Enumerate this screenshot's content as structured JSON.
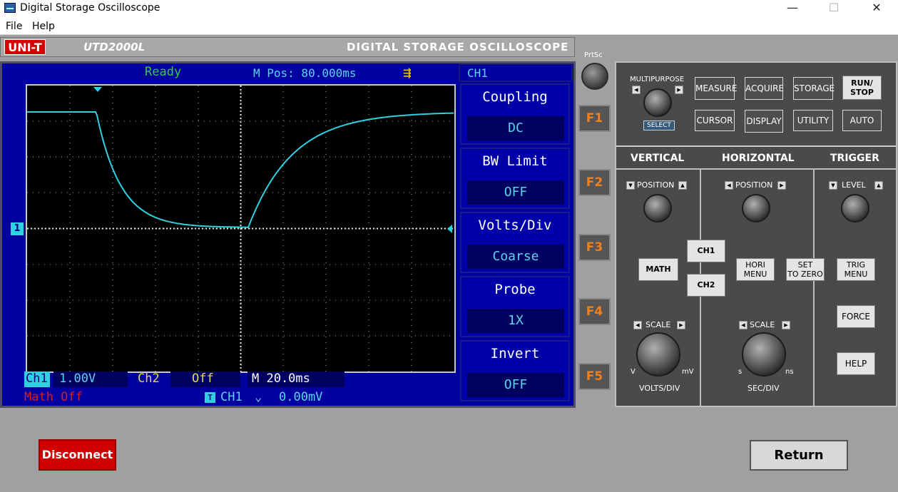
{
  "window": {
    "title": "Digital Storage Oscilloscope",
    "minimize": "—",
    "maximize": "☐",
    "close": "✕"
  },
  "menu": {
    "file": "File",
    "help": "Help"
  },
  "brand": {
    "logo": "UNI-T",
    "model": "UTD2000L",
    "product": "DIGITAL  STORAGE  OSCILLOSCOPE"
  },
  "screen": {
    "status": "Ready",
    "mpos": "M Pos: 80.000ms",
    "channel": "CH1",
    "ch_marker": "1",
    "ch1_label": "Ch1",
    "ch1_value": "1.00V",
    "ch2_label": "Ch2",
    "ch2_value": "Off",
    "time_label": "M 20.0ms",
    "math": "Math Off",
    "trig_icon": "T",
    "trig_ch": "CH1",
    "trig_slope": "⌄",
    "trig_level": "0.00mV"
  },
  "softmenus": [
    {
      "label": "Coupling",
      "value": "DC"
    },
    {
      "label": "BW  Limit",
      "value": "OFF"
    },
    {
      "label": "Volts/Div",
      "value": "Coarse"
    },
    {
      "label": "Probe",
      "value": "1X"
    },
    {
      "label": "Invert",
      "value": "OFF"
    }
  ],
  "fbuttons": [
    "F1",
    "F2",
    "F3",
    "F4",
    "F5"
  ],
  "prtsc": "PrtSc",
  "panel": {
    "multipurpose": "MULTIPURPOSE",
    "select": "SELECT",
    "measure": "MEASURE",
    "acquire": "ACQUIRE",
    "storage": "STORAGE",
    "run_stop_1": "RUN/",
    "run_stop_2": "STOP",
    "cursor": "CURSOR",
    "display": "DISPLAY",
    "utility": "UTILITY",
    "auto": "AUTO",
    "vertical": "VERTICAL",
    "horizontal": "HORIZONTAL",
    "trigger": "TRIGGER",
    "v_position": "POSITION",
    "h_position": "POSITION",
    "level": "LEVEL",
    "math": "MATH",
    "ch1": "CH1",
    "ch2": "CH2",
    "hori_menu_1": "HORI",
    "hori_menu_2": "MENU",
    "set_zero_1": "SET",
    "set_zero_2": "TO ZERO",
    "trig_menu_1": "TRIG",
    "trig_menu_2": "MENU",
    "force": "FORCE",
    "help": "HELP",
    "v_scale": "SCALE",
    "h_scale": "SCALE",
    "v_unit_left": "V",
    "v_unit_right": "mV",
    "h_unit_left": "s",
    "h_unit_right": "ns",
    "volts_div": "VOLTS/DIV",
    "sec_div": "SEC/DIV"
  },
  "buttons": {
    "disconnect": "Disconnect",
    "return": "Return"
  },
  "colors": {
    "trace": "#2fd0e0",
    "screen_bg": "#0000a0",
    "grid": "#c8c8c8"
  }
}
